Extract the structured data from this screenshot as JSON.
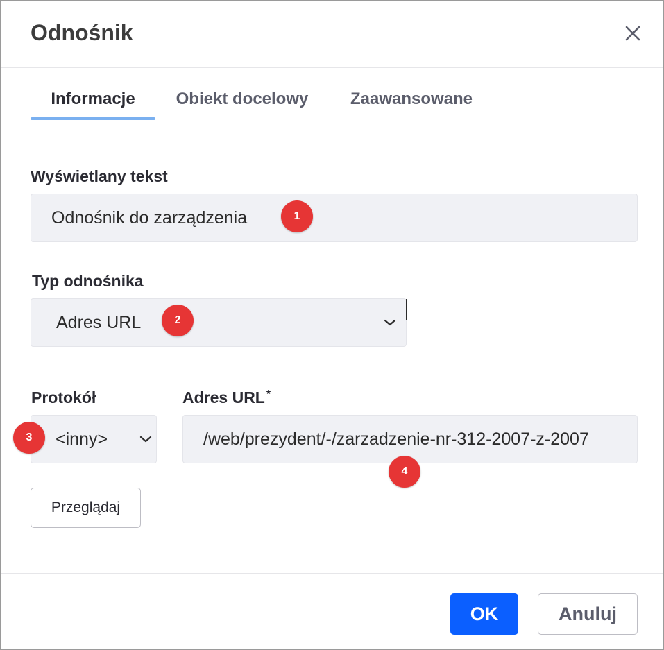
{
  "dialog": {
    "title": "Odnośnik",
    "close_icon": "close-icon"
  },
  "tabs": [
    {
      "label": "Informacje",
      "active": true
    },
    {
      "label": "Obiekt docelowy",
      "active": false
    },
    {
      "label": "Zaawansowane",
      "active": false
    }
  ],
  "display_text": {
    "label": "Wyświetlany tekst",
    "value": "Odnośnik do zarządzenia"
  },
  "link_type": {
    "label": "Typ odnośnika",
    "selected": "Adres URL"
  },
  "protocol": {
    "label": "Protokół",
    "selected": "<inny>"
  },
  "url": {
    "label": "Adres URL",
    "required_marker": "*",
    "value": "/web/prezydent/-/zarzadzenie-nr-312-2007-z-2007"
  },
  "browse_button": "Przeglądaj",
  "footer": {
    "ok_label": "OK",
    "cancel_label": "Anuluj"
  },
  "annotations": [
    "1",
    "2",
    "3",
    "4"
  ],
  "colors": {
    "accent": "#0b5fff",
    "tab_underline": "#7ab0f0",
    "badge": "#e63535"
  }
}
